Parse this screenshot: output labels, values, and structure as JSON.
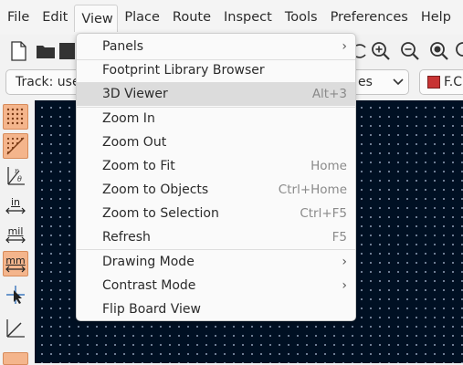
{
  "menubar": {
    "items": [
      {
        "label": "File"
      },
      {
        "label": "Edit"
      },
      {
        "label": "View"
      },
      {
        "label": "Place"
      },
      {
        "label": "Route"
      },
      {
        "label": "Inspect"
      },
      {
        "label": "Tools"
      },
      {
        "label": "Preferences"
      },
      {
        "label": "Help"
      }
    ]
  },
  "toolbar2": {
    "track_combo": "Track: use",
    "via_combo_tail": "es",
    "layer_combo": "F.Cu",
    "layer_color": "#c83434"
  },
  "view_menu": {
    "items": [
      {
        "label": "Panels",
        "shortcut": "",
        "submenu": true
      },
      {
        "label": "Footprint Library Browser",
        "shortcut": "",
        "submenu": false
      },
      {
        "label": "3D Viewer",
        "shortcut": "Alt+3",
        "submenu": false,
        "highlighted": true
      },
      {
        "label": "Zoom In",
        "shortcut": "",
        "submenu": false
      },
      {
        "label": "Zoom Out",
        "shortcut": "",
        "submenu": false
      },
      {
        "label": "Zoom to Fit",
        "shortcut": "Home",
        "submenu": false
      },
      {
        "label": "Zoom to Objects",
        "shortcut": "Ctrl+Home",
        "submenu": false
      },
      {
        "label": "Zoom to Selection",
        "shortcut": "Ctrl+F5",
        "submenu": false
      },
      {
        "label": "Refresh",
        "shortcut": "F5",
        "submenu": false
      },
      {
        "label": "Drawing Mode",
        "shortcut": "",
        "submenu": true
      },
      {
        "label": "Contrast Mode",
        "shortcut": "",
        "submenu": true
      },
      {
        "label": "Flip Board View",
        "shortcut": "",
        "submenu": false
      }
    ],
    "submenu_glyph": "›"
  },
  "left_toolbar": {
    "units_in": "in",
    "units_mil": "mil",
    "units_mm": "mm"
  },
  "colors": {
    "canvas_background": "#001023",
    "active_tool": "#f4b58c",
    "highlight": "#dcdcdc"
  }
}
